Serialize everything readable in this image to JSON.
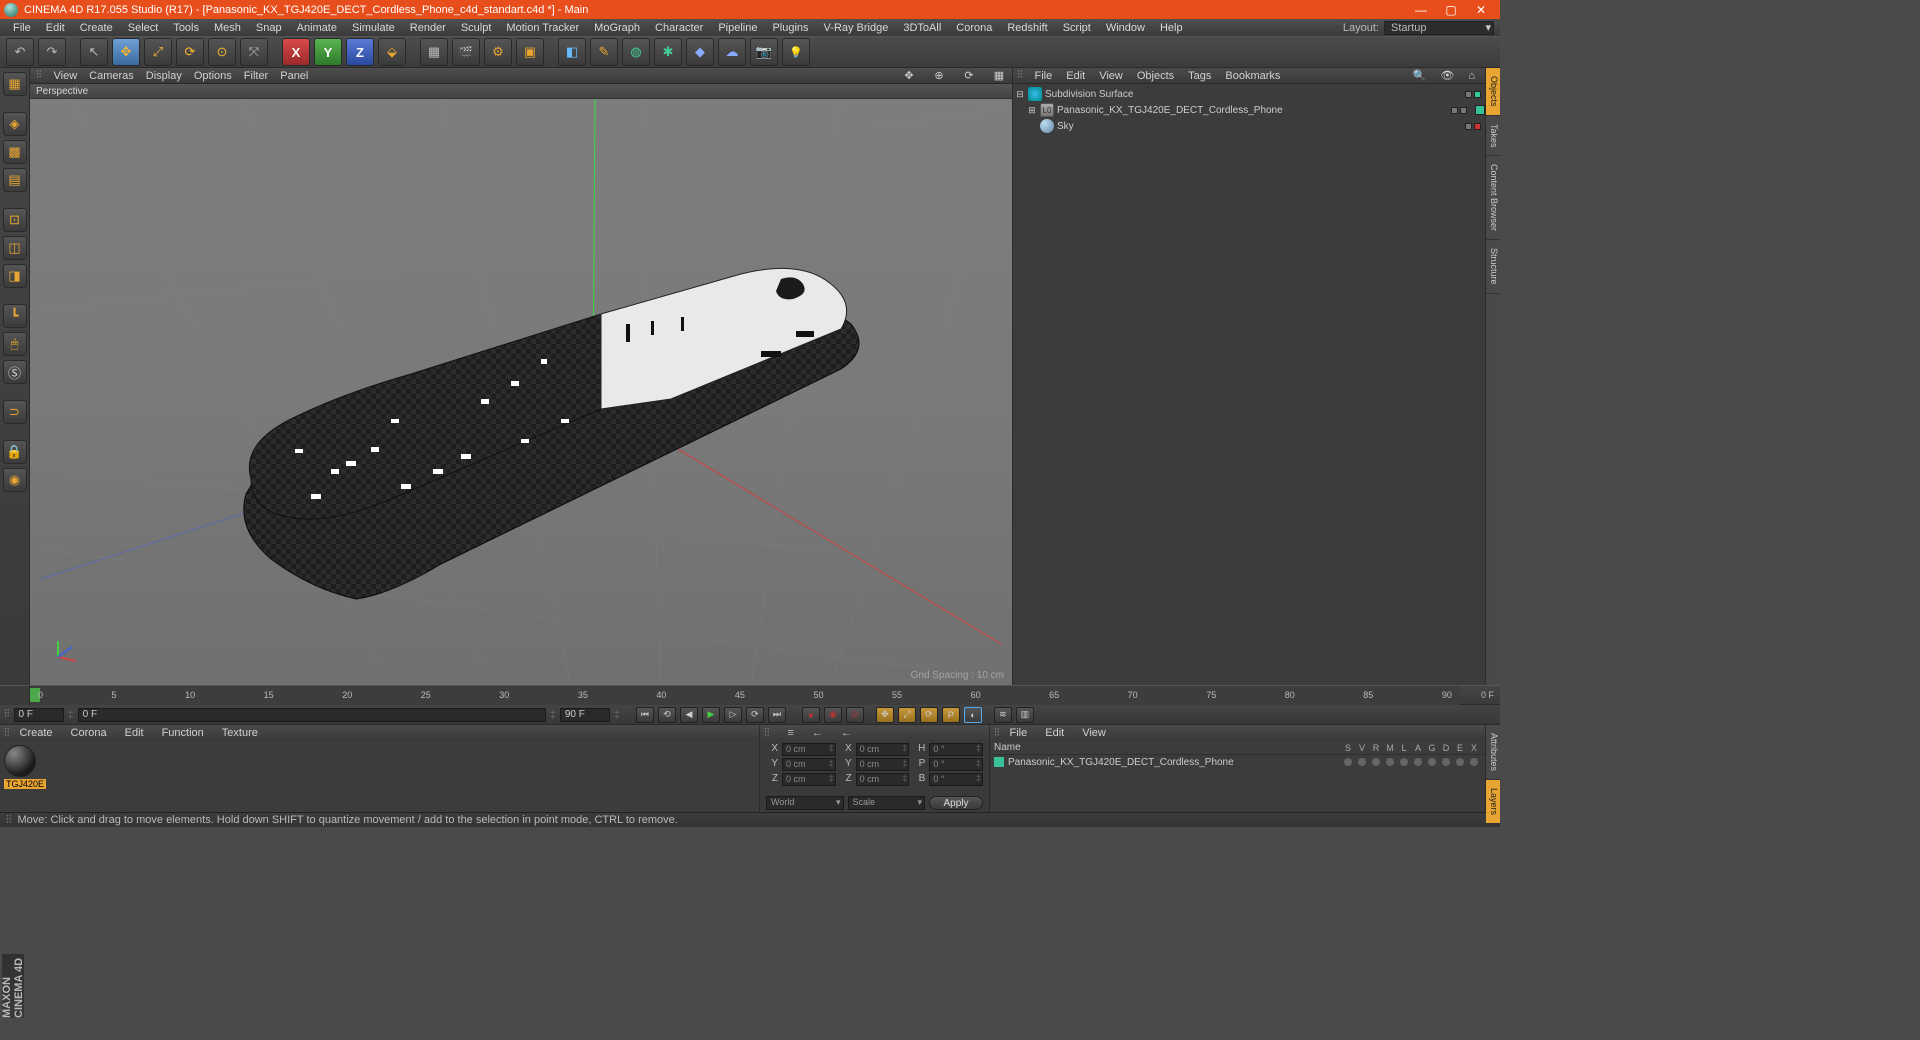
{
  "titlebar": {
    "title": "CINEMA 4D R17.055 Studio (R17) - [Panasonic_KX_TGJ420E_DECT_Cordless_Phone_c4d_standart.c4d *] - Main"
  },
  "menubar": {
    "items": [
      "File",
      "Edit",
      "Create",
      "Select",
      "Tools",
      "Mesh",
      "Snap",
      "Animate",
      "Simulate",
      "Render",
      "Sculpt",
      "Motion Tracker",
      "MoGraph",
      "Character",
      "Pipeline",
      "Plugins",
      "V-Ray Bridge",
      "3DToAll",
      "Corona",
      "Redshift",
      "Script",
      "Window",
      "Help"
    ],
    "layout_label": "Layout:",
    "layout_value": "Startup"
  },
  "axis": {
    "x": "X",
    "y": "Y",
    "z": "Z"
  },
  "viewport": {
    "menus": [
      "View",
      "Cameras",
      "Display",
      "Options",
      "Filter",
      "Panel"
    ],
    "header": "Perspective",
    "grid_info": "Grid Spacing : 10 cm"
  },
  "objects_panel": {
    "tabs": [
      "File",
      "Edit",
      "View",
      "Objects",
      "Tags",
      "Bookmarks"
    ],
    "tree": [
      {
        "name": "Subdivision Surface",
        "icon": "subdiv",
        "indent": 0,
        "toggle": "⊟",
        "dots": [
          "gray",
          "green"
        ]
      },
      {
        "name": "Panasonic_KX_TGJ420E_DECT_Cordless_Phone",
        "icon": "null",
        "indent": 1,
        "toggle": "⊞",
        "dots": [
          "gray",
          "gray"
        ],
        "tag": true
      },
      {
        "name": "Sky",
        "icon": "sky",
        "indent": 1,
        "toggle": "",
        "dots": [
          "gray",
          "red"
        ]
      }
    ]
  },
  "side_tabs_top": [
    "Objects",
    "Takes",
    "Content Browser",
    "Structure"
  ],
  "side_tabs_bottom": [
    "Attributes",
    "Layers"
  ],
  "timeline": {
    "start": "0",
    "end_label": "0 F",
    "ticks": [
      "0",
      "5",
      "10",
      "15",
      "20",
      "25",
      "30",
      "35",
      "40",
      "45",
      "50",
      "55",
      "60",
      "65",
      "70",
      "75",
      "80",
      "85",
      "90"
    ]
  },
  "transport": {
    "frame_start": "0 F",
    "frame_cur": "0 F",
    "frame_end": "90 F"
  },
  "materials": {
    "tabs": [
      "Create",
      "Corona",
      "Edit",
      "Function",
      "Texture"
    ],
    "item_label": "TGJ420E"
  },
  "coords": {
    "tabs": [
      "≡",
      "←",
      "→",
      "←",
      "←"
    ],
    "rows": [
      {
        "l1": "X",
        "v1": "0 cm",
        "l2": "X",
        "v2": "0 cm",
        "l3": "H",
        "v3": "0 °"
      },
      {
        "l1": "Y",
        "v1": "0 cm",
        "l2": "Y",
        "v2": "0 cm",
        "l3": "P",
        "v3": "0 °"
      },
      {
        "l1": "Z",
        "v1": "0 cm",
        "l2": "Z",
        "v2": "0 cm",
        "l3": "B",
        "v3": "0 °"
      }
    ],
    "sel1": "World",
    "sel2": "Scale",
    "apply": "Apply"
  },
  "attributes": {
    "tabs": [
      "File",
      "Edit",
      "View"
    ],
    "header_name": "Name",
    "header_cols": [
      "S",
      "V",
      "R",
      "M",
      "L",
      "A",
      "G",
      "D",
      "E",
      "X"
    ],
    "row_name": "Panasonic_KX_TGJ420E_DECT_Cordless_Phone"
  },
  "statusbar": {
    "text": "Move: Click and drag to move elements. Hold down SHIFT to quantize movement / add to the selection in point mode, CTRL to remove."
  },
  "maxon": "MAXON CINEMA 4D"
}
